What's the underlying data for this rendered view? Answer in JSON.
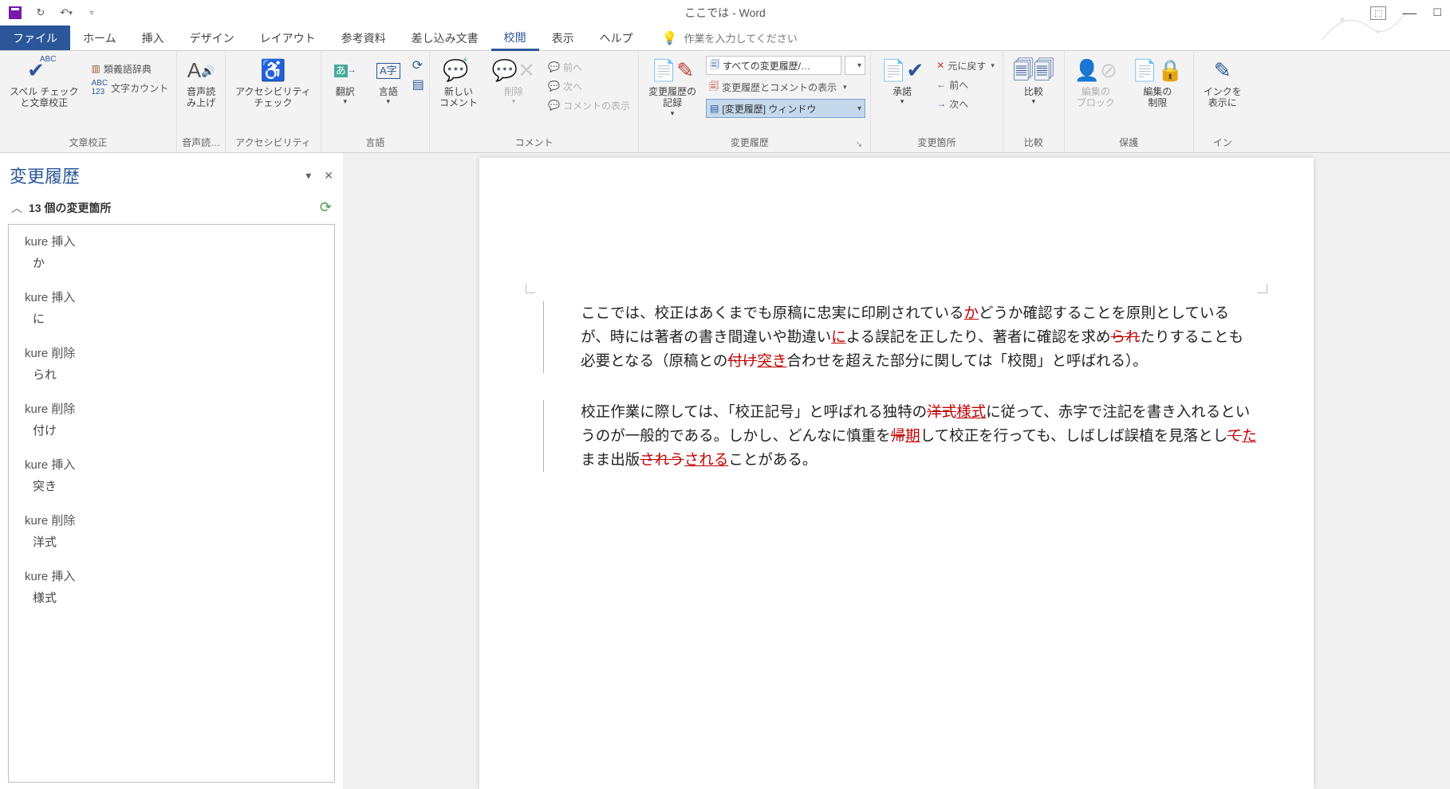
{
  "title": "ここでは  -  Word",
  "tabs": {
    "file": "ファイル",
    "home": "ホーム",
    "insert": "挿入",
    "design": "デザイン",
    "layout": "レイアウト",
    "references": "参考資料",
    "mailings": "差し込み文書",
    "review": "校閲",
    "view": "表示",
    "help": "ヘルプ"
  },
  "tellme": "作業を入力してください",
  "ribbon": {
    "proofing": {
      "spell": "スペル チェック\nと文章校正",
      "thesaurus": "類義語辞典",
      "wordcount": "文字カウント",
      "label": "文章校正"
    },
    "speech": {
      "read": "音声読\nみ上げ",
      "label": "音声読…"
    },
    "accessibility": {
      "check": "アクセシビリティ\nチェック",
      "label": "アクセシビリティ"
    },
    "language": {
      "translate": "翻訳",
      "lang": "言語",
      "label": "言語"
    },
    "comments": {
      "new": "新しい\nコメント",
      "delete": "削除",
      "prev": "前へ",
      "next": "次へ",
      "show": "コメントの表示",
      "label": "コメント"
    },
    "tracking": {
      "track": "変更履歴の\n記録",
      "display": "すべての変更履歴/…",
      "showmarkup": "変更履歴とコメントの表示",
      "pane": "[変更履歴] ウィンドウ",
      "label": "変更履歴"
    },
    "changes": {
      "accept": "承諾",
      "revert": "元に戻す",
      "prev": "前へ",
      "next": "次へ",
      "label": "変更箇所"
    },
    "compare": {
      "compare": "比較",
      "label": "比較"
    },
    "protect": {
      "block": "編集の\nブロック",
      "restrict": "編集の\n制限",
      "label": "保護"
    },
    "ink": {
      "hide": "インクを\n表示に",
      "label": "イン"
    }
  },
  "revpane": {
    "title": "変更履歴",
    "count": "13 個の変更箇所",
    "items": [
      {
        "who": "kure 挿入",
        "txt": "か"
      },
      {
        "who": "kure 挿入",
        "txt": "に"
      },
      {
        "who": "kure 削除",
        "txt": "られ"
      },
      {
        "who": "kure 削除",
        "txt": "付け"
      },
      {
        "who": "kure 挿入",
        "txt": "突き"
      },
      {
        "who": "kure 削除",
        "txt": "洋式"
      },
      {
        "who": "kure 挿入",
        "txt": "様式"
      }
    ]
  },
  "doc": {
    "p1a": "ここでは、校正はあくまでも原稿に忠実に印刷されている",
    "p1ins1": "か",
    "p1b": "どうか確認することを原則としているが、時には著者の書き間違いや勘違い",
    "p1ins2": "に",
    "p1c": "よる誤記を正したり、著者に確認を求め",
    "p1del1": "られ",
    "p1d": "たりすることも必要となる（原稿との",
    "p1del2": "付け",
    "p1ins3": "突き",
    "p1e": "合わせを超えた部分に関しては「校閲」と呼ばれる）。",
    "p2a": "校正作業に際しては、「校正記号」と呼ばれる独特の",
    "p2del1": "洋式",
    "p2ins1": "様式",
    "p2b": "に従って、赤字で注記を書き入れるというのが一般的である。しかし、どんなに慎重を",
    "p2del2": "帰",
    "p2ins2": "期",
    "p2c": "して校正を行っても、しばしば誤植を見落とし",
    "p2del3": "て",
    "p2ins3": "た",
    "p2d": "まま出版",
    "p2del4": "されう",
    "p2ins4": "される",
    "p2e": "ことがある。"
  }
}
